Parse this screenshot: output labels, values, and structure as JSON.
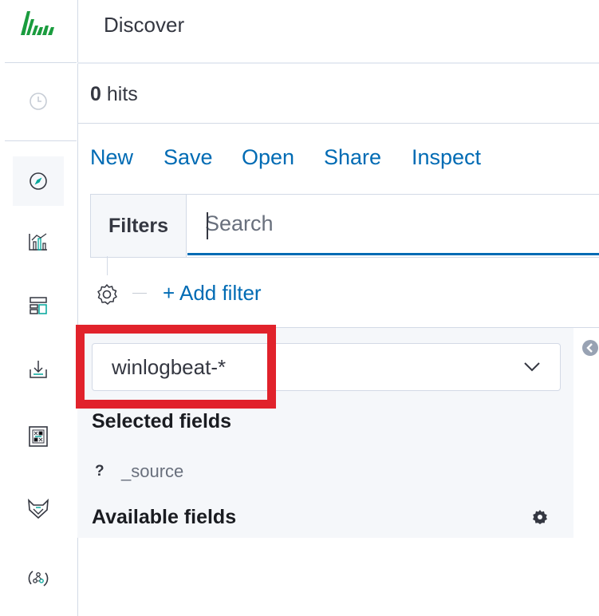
{
  "app": {
    "page_title": "Discover",
    "logo_icon": "elastic-logo-icon"
  },
  "nav": {
    "items": [
      {
        "name": "recent-icon",
        "active": false
      },
      {
        "name": "discover-compass-icon",
        "active": true
      },
      {
        "name": "visualize-icon",
        "active": false
      },
      {
        "name": "dashboard-icon",
        "active": false
      },
      {
        "name": "ingest-icon",
        "active": false
      },
      {
        "name": "canvas-icon",
        "active": false
      },
      {
        "name": "siem-fox-icon",
        "active": false
      },
      {
        "name": "graph-icon",
        "active": false
      }
    ]
  },
  "hits": {
    "count": "0",
    "label": "hits"
  },
  "menu": {
    "new": "New",
    "save": "Save",
    "open": "Open",
    "share": "Share",
    "inspect": "Inspect"
  },
  "filter_bar": {
    "filters_label": "Filters",
    "search_placeholder": "Search",
    "add_filter": "+ Add filter"
  },
  "sidebar": {
    "index_pattern": "winlogbeat-*",
    "selected_fields_title": "Selected fields",
    "selected_fields": [
      {
        "type": "?",
        "name": "_source"
      }
    ],
    "available_fields_title": "Available fields"
  },
  "colors": {
    "link": "#006bb4",
    "highlight": "#e1222b",
    "logo": "#1a9c3e"
  }
}
